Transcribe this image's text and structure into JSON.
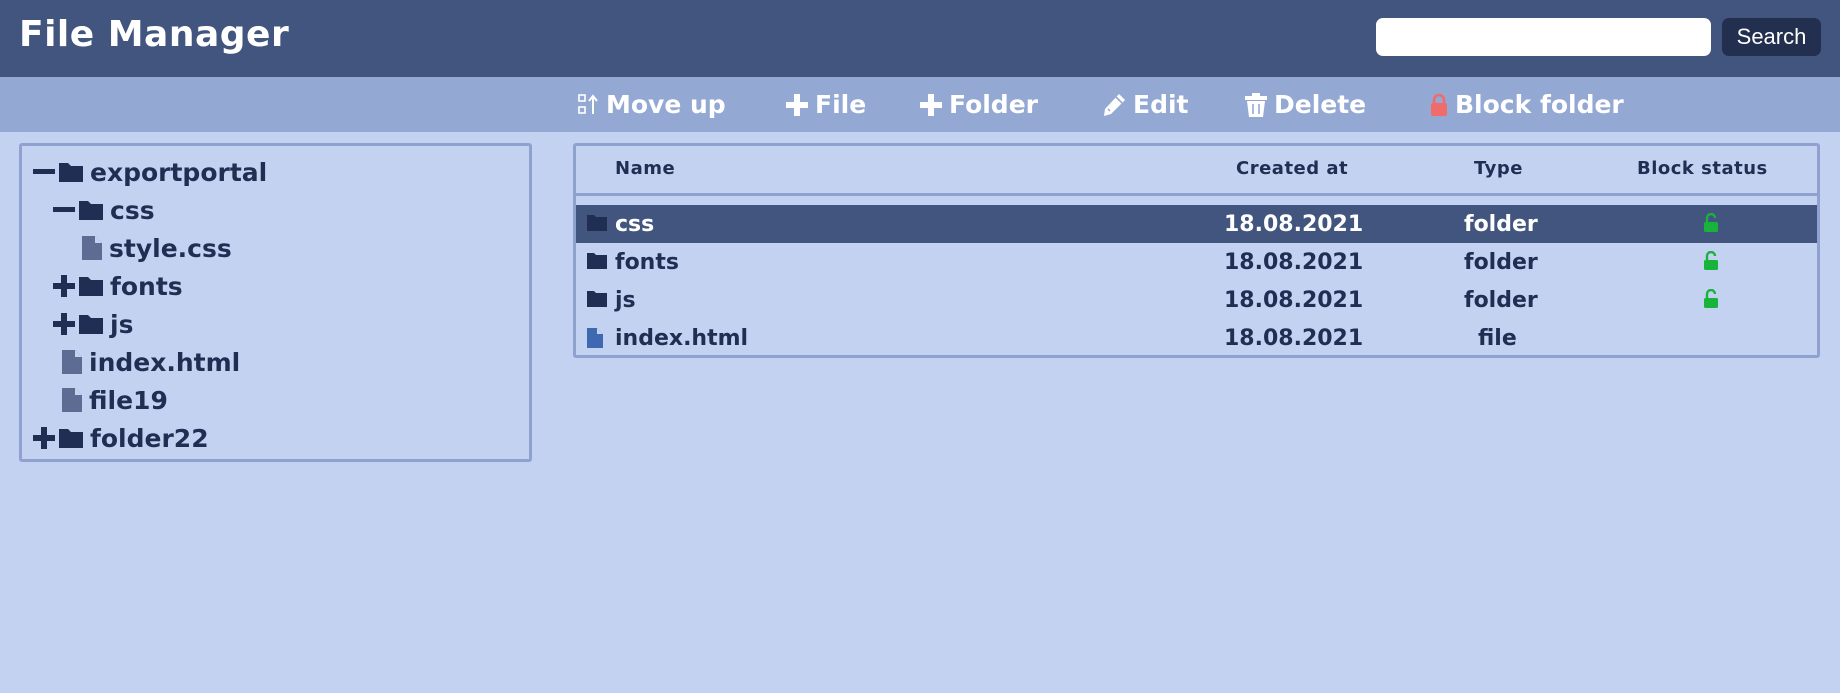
{
  "header": {
    "title": "File Manager",
    "search_value": "",
    "search_placeholder": "",
    "search_button": "Search"
  },
  "toolbar": {
    "move_up": "Move up",
    "add_file": "File",
    "add_folder": "Folder",
    "edit": "Edit",
    "delete": "Delete",
    "block_folder": "Block folder"
  },
  "tree": [
    {
      "label": "exportportal",
      "kind": "folder",
      "state": "expanded",
      "depth": 0
    },
    {
      "label": "css",
      "kind": "folder",
      "state": "expanded",
      "depth": 1
    },
    {
      "label": "style.css",
      "kind": "file",
      "state": "leaf",
      "depth": 2
    },
    {
      "label": "fonts",
      "kind": "folder",
      "state": "collapsed",
      "depth": 1
    },
    {
      "label": "js",
      "kind": "folder",
      "state": "collapsed",
      "depth": 1
    },
    {
      "label": "index.html",
      "kind": "file",
      "state": "leaf",
      "depth": 1
    },
    {
      "label": "file19",
      "kind": "file",
      "state": "leaf",
      "depth": 1
    },
    {
      "label": "folder22",
      "kind": "folder",
      "state": "collapsed",
      "depth": 0
    }
  ],
  "list": {
    "columns": {
      "name": "Name",
      "created_at": "Created at",
      "type": "Type",
      "block_status": "Block status"
    },
    "rows": [
      {
        "name": "css",
        "created_at": "18.08.2021",
        "type": "folder",
        "block_status": "unlocked",
        "selected": true
      },
      {
        "name": "fonts",
        "created_at": "18.08.2021",
        "type": "folder",
        "block_status": "unlocked",
        "selected": false
      },
      {
        "name": "js",
        "created_at": "18.08.2021",
        "type": "folder",
        "block_status": "unlocked",
        "selected": false
      },
      {
        "name": "index.html",
        "created_at": "18.08.2021",
        "type": "file",
        "block_status": "",
        "selected": false
      }
    ]
  },
  "colors": {
    "header_bg": "#41557f",
    "toolbar_bg": "#94a8d4",
    "page_bg": "#c4d2f2",
    "selected_row_bg": "#41557f",
    "lock_icon": "#f26b6b",
    "unlock_icon": "#17b33a"
  },
  "icons": {
    "move_up": "move-up-icon",
    "add_file": "plus-icon",
    "add_folder": "plus-icon",
    "edit": "pencil-icon",
    "delete": "trash-icon",
    "block_folder": "lock-icon",
    "folder": "folder-icon",
    "file": "file-icon",
    "expand": "plus-icon",
    "collapse": "minus-icon",
    "unlocked": "unlock-icon"
  }
}
